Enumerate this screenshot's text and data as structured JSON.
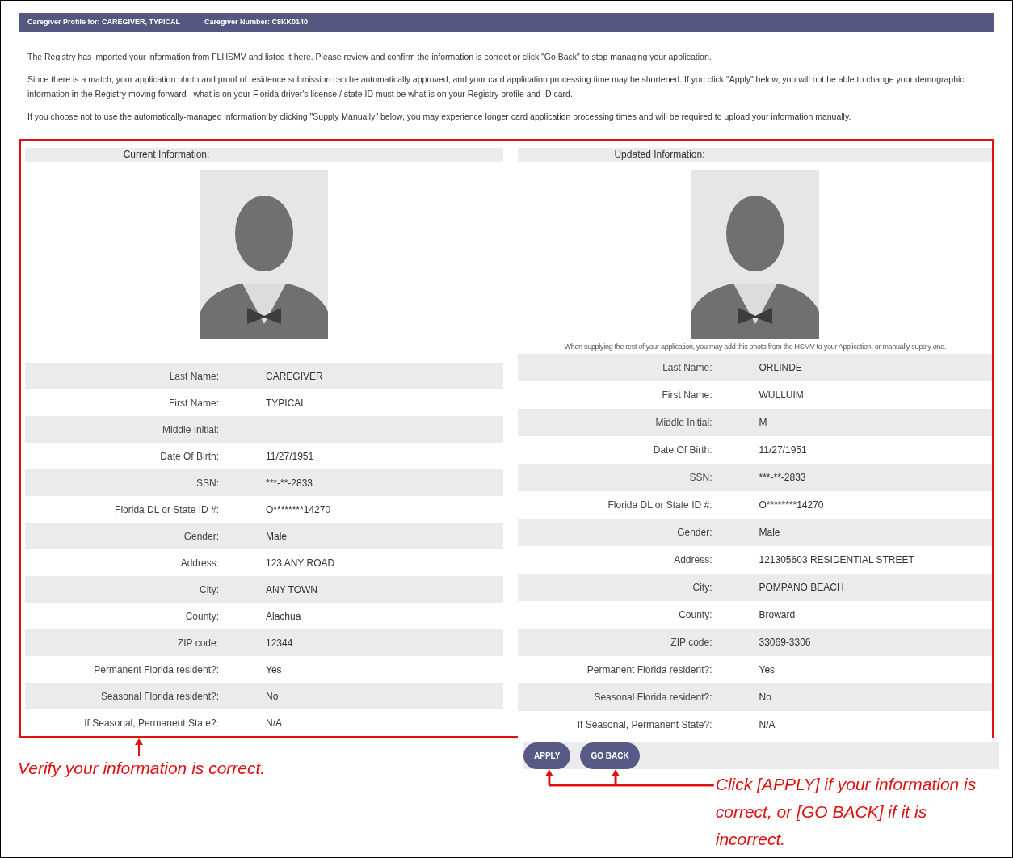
{
  "header": {
    "profile": "Caregiver Profile for: CAREGIVER, TYPICAL",
    "number": "Caregiver Number: C8KK0140"
  },
  "intro_paragraphs": [
    "The Registry has imported your information from FLHSMV and listed it here. Please review and confirm the information is correct or click \"Go Back\" to stop managing your application.",
    "Since there is a match, your application photo and proof of residence submission can be automatically approved, and your card application processing time may be shortened. If you click \"Apply\" below, you will not be able to change your demographic information in the Registry moving forward– what is on your Florida driver's license / state ID must be what is on your Registry profile and ID card.",
    "If you choose not to use the automatically-managed information by clicking \"Supply Manually\" below, you may experience longer card application processing times and will be required to upload your information manually."
  ],
  "panels": [
    {
      "heading": "Current Information:",
      "fields": [
        {
          "label": "Last Name:",
          "value": "CAREGIVER"
        },
        {
          "label": "First Name:",
          "value": "TYPICAL"
        },
        {
          "label": "Middle Initial:"
        },
        {
          "label": "Date Of Birth:",
          "value": "11/27/1951"
        },
        {
          "label": "SSN:",
          "value": "***-**-2833"
        },
        {
          "label": "Florida DL or State ID #:",
          "value": "O********14270"
        },
        {
          "label": "Gender:",
          "value": "Male"
        },
        {
          "label": "Address:",
          "value": "123 ANY ROAD"
        },
        {
          "label": "City:",
          "value": "ANY TOWN"
        },
        {
          "label": "County:",
          "value": "Alachua"
        },
        {
          "label": "ZIP code:",
          "value": "12344"
        },
        {
          "label": "Permanent Florida resident?:",
          "value": "Yes"
        },
        {
          "label": "Seasonal Florida resident?:",
          "value": "No"
        },
        {
          "label": "If Seasonal, Permanent State?:",
          "value": "N/A"
        }
      ]
    },
    {
      "heading": "Updated Information:",
      "photo_caption": "When supplying the rest of your application, you may add this photo from the HSMV to your Application, or manually supply one.",
      "fields": [
        {
          "label": "Last Name:",
          "value": "ORLINDE"
        },
        {
          "label": "First Name:",
          "value": "WULLUIM"
        },
        {
          "label": "Middle Initial:",
          "value": "M"
        },
        {
          "label": "Date Of Birth:",
          "value": "11/27/1951"
        },
        {
          "label": "SSN:",
          "value": "***-**-2833"
        },
        {
          "label": "Florida DL or State ID #:",
          "value": "O********14270"
        },
        {
          "label": "Gender:",
          "value": "Male"
        },
        {
          "label": "Address:",
          "value": "121305603 RESIDENTIAL STREET"
        },
        {
          "label": "City:",
          "value": "POMPANO BEACH"
        },
        {
          "label": "County:",
          "value": "Broward"
        },
        {
          "label": "ZIP code:",
          "value": "33069-3306"
        },
        {
          "label": "Permanent Florida resident?:",
          "value": "Yes"
        },
        {
          "label": "Seasonal Florida resident?:",
          "value": "No"
        },
        {
          "label": "If Seasonal, Permanent State?:",
          "value": "N/A"
        }
      ]
    }
  ],
  "buttons": [
    {
      "label": "APPLY"
    },
    {
      "label": "GO BACK"
    }
  ],
  "annotations": [
    {
      "text": "Verify your information is correct."
    },
    {
      "text": "Click [APPLY] if your information is correct, or [GO BACK] if it is incorrect."
    }
  ]
}
